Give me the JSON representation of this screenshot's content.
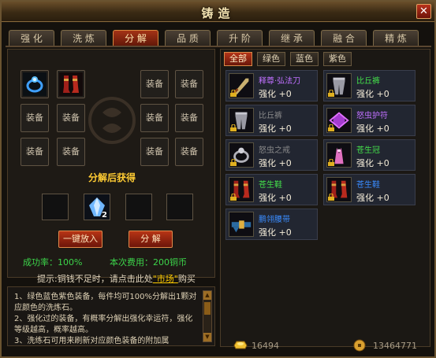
{
  "window": {
    "title": "铸造",
    "close_label": "✕"
  },
  "tabs": [
    {
      "label": "强 化",
      "active": false
    },
    {
      "label": "洗 炼",
      "active": false
    },
    {
      "label": "分 解",
      "active": true
    },
    {
      "label": "品 质",
      "active": false
    },
    {
      "label": "升 阶",
      "active": false
    },
    {
      "label": "继 承",
      "active": false
    },
    {
      "label": "融 合",
      "active": false
    },
    {
      "label": "精 炼",
      "active": false
    }
  ],
  "equip_slots": {
    "empty_label": "装备",
    "filled": [
      {
        "icon": "ring-icon"
      },
      {
        "icon": "boots-icon"
      }
    ]
  },
  "result": {
    "label": "分解后获得",
    "crystal_count": "2"
  },
  "buttons": {
    "auto_fill": "一键放入",
    "decompose": "分 解"
  },
  "stats": {
    "success_rate": "成功率：100%",
    "fee": "本次费用：200铜币"
  },
  "tip": {
    "prefix": "提示:铜钱不足时，请点击此处",
    "link": "\"市场\"",
    "suffix": "购买"
  },
  "description": [
    "1、绿色蓝色紫色装备，每件均可100%分解出1颗对应颜色的洗炼石。",
    "2、强化过的装备，有概率分解出强化幸运符，强化等级越高，概率越高。",
    "3、洗练石可用来刷新对应颜色装备的附加属"
  ],
  "filters": [
    {
      "label": "全部",
      "active": true
    },
    {
      "label": "绿色",
      "active": false
    },
    {
      "label": "蓝色",
      "active": false
    },
    {
      "label": "紫色",
      "active": false
    }
  ],
  "inventory": [
    {
      "name": "释尊·弘法刀",
      "level": "强化 +0",
      "color": "#c070ff",
      "icon": "sword-icon",
      "locked": true
    },
    {
      "name": "比丘裤",
      "level": "强化 +0",
      "color": "#44e04a",
      "icon": "pants-icon",
      "locked": true
    },
    {
      "name": "比丘裤",
      "level": "强化 +0",
      "color": "#8a8a8a",
      "icon": "pants-icon",
      "locked": true
    },
    {
      "name": "怒虫护符",
      "level": "强化 +0",
      "color": "#c070ff",
      "icon": "amulet-icon",
      "locked": true
    },
    {
      "name": "怒虫之戒",
      "level": "强化 +0",
      "color": "#8a8a8a",
      "icon": "ring-icon",
      "locked": true
    },
    {
      "name": "苍生冠",
      "level": "强化 +0",
      "color": "#44e04a",
      "icon": "crown-icon",
      "locked": true
    },
    {
      "name": "苍生鞋",
      "level": "强化 +0",
      "color": "#44e04a",
      "icon": "boots-icon",
      "locked": true
    },
    {
      "name": "苍生鞋",
      "level": "强化 +0",
      "color": "#3a8cff",
      "icon": "boots-icon",
      "locked": true
    },
    {
      "name": "鹏翎腰带",
      "level": "强化 +0",
      "color": "#3a8cff",
      "icon": "belt-icon",
      "locked": false
    }
  ],
  "currency": {
    "gold_icon": "gold-ingot-icon",
    "gold": "16494",
    "coin_icon": "copper-coin-icon",
    "coin": "13464771"
  },
  "colors": {
    "accent_red": "#b4351a",
    "green_text": "#3cd44a",
    "gold_text": "#ffcc33"
  }
}
